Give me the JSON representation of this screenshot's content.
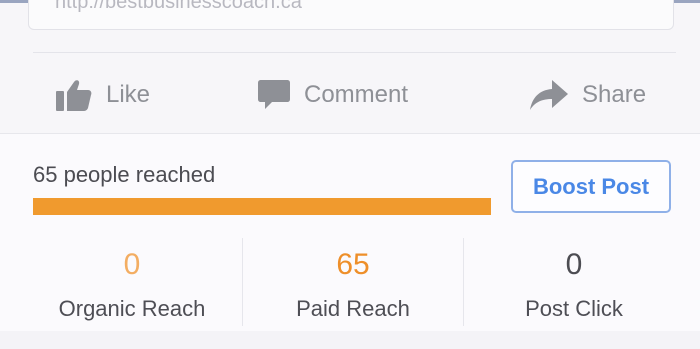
{
  "link_preview": {
    "url": "http://bestbusinesscoach.ca"
  },
  "actions": {
    "like": {
      "label": "Like",
      "icon": "thumbs-up-icon"
    },
    "comment": {
      "label": "Comment",
      "icon": "speech-bubble-icon"
    },
    "share": {
      "label": "Share",
      "icon": "share-arrow-icon"
    }
  },
  "insights": {
    "reach_text": "65 people reached",
    "reach_fraction": 1.0,
    "boost_label": "Boost Post",
    "stats": [
      {
        "value": "0",
        "label": "Organic Reach",
        "color": "#f3ad62"
      },
      {
        "value": "65",
        "label": "Paid Reach",
        "color": "#ee8f2a"
      },
      {
        "value": "0",
        "label": "Post Click",
        "color": "#4c4c52"
      }
    ]
  },
  "colors": {
    "accent_orange": "#f09a2e",
    "boost_blue": "#4a88e6",
    "muted_text": "#8e9096"
  }
}
